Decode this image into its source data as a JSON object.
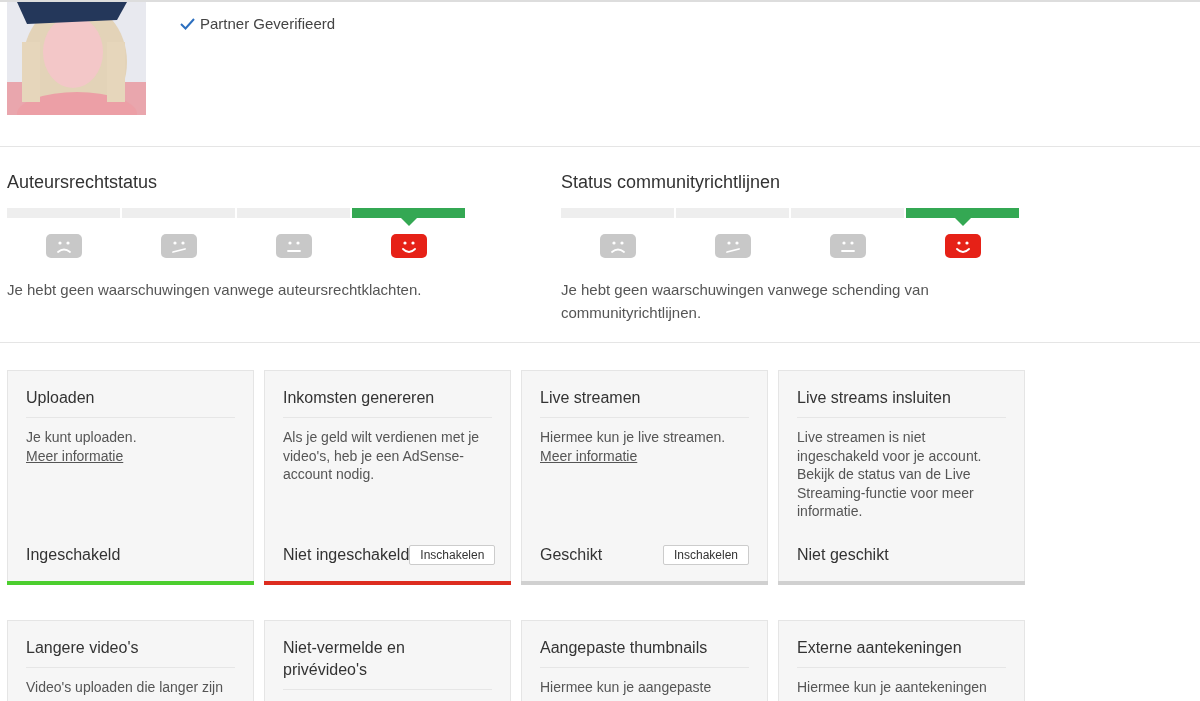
{
  "profile": {
    "badge": "Partner Geverifieerd"
  },
  "meters": [
    {
      "title": "Auteursrechtstatus",
      "segments": [
        {
          "kind": "sad",
          "selected": false
        },
        {
          "kind": "unsure",
          "selected": false
        },
        {
          "kind": "neutral",
          "selected": false
        },
        {
          "kind": "happy",
          "selected": true
        }
      ],
      "message": "Je hebt geen waarschuwingen vanwege auteursrechtklachten."
    },
    {
      "title": "Status communityrichtlijnen",
      "segments": [
        {
          "kind": "sad",
          "selected": false
        },
        {
          "kind": "unsure",
          "selected": false
        },
        {
          "kind": "neutral",
          "selected": false
        },
        {
          "kind": "happy",
          "selected": true
        }
      ],
      "message": "Je hebt geen waarschuwingen vanwege schending van communityrichtlijnen."
    }
  ],
  "cards": [
    {
      "title": "Uploaden",
      "text": "Je kunt uploaden.",
      "link": "Meer informatie",
      "status": "Ingeschakeld",
      "kind": "enabled"
    },
    {
      "title": "Inkomsten genereren",
      "text": "Als je geld wilt verdienen met je video's, heb je een AdSense-account nodig.",
      "status": "Niet ingeschakeld",
      "button": "Inschakelen",
      "kind": "disabled"
    },
    {
      "title": "Live streamen",
      "text": "Hiermee kun je live streamen.",
      "link": "Meer informatie",
      "status": "Geschikt",
      "button": "Inschakelen",
      "kind": "eligible"
    },
    {
      "title": "Live streams insluiten",
      "text": "Live streamen is niet ingeschakeld voor je account. Bekijk de status van de Live Streaming-functie voor meer informatie.",
      "status": "Niet geschikt",
      "kind": "ineligible"
    },
    {
      "title": "Langere video's",
      "text": "Video's uploaden die langer zijn"
    },
    {
      "title": "Niet-vermelde en privévideo's"
    },
    {
      "title": "Aangepaste thumbnails",
      "text": "Hiermee kun je aangepaste"
    },
    {
      "title": "Externe aantekeningen",
      "text": "Hiermee kun je aantekeningen"
    }
  ]
}
